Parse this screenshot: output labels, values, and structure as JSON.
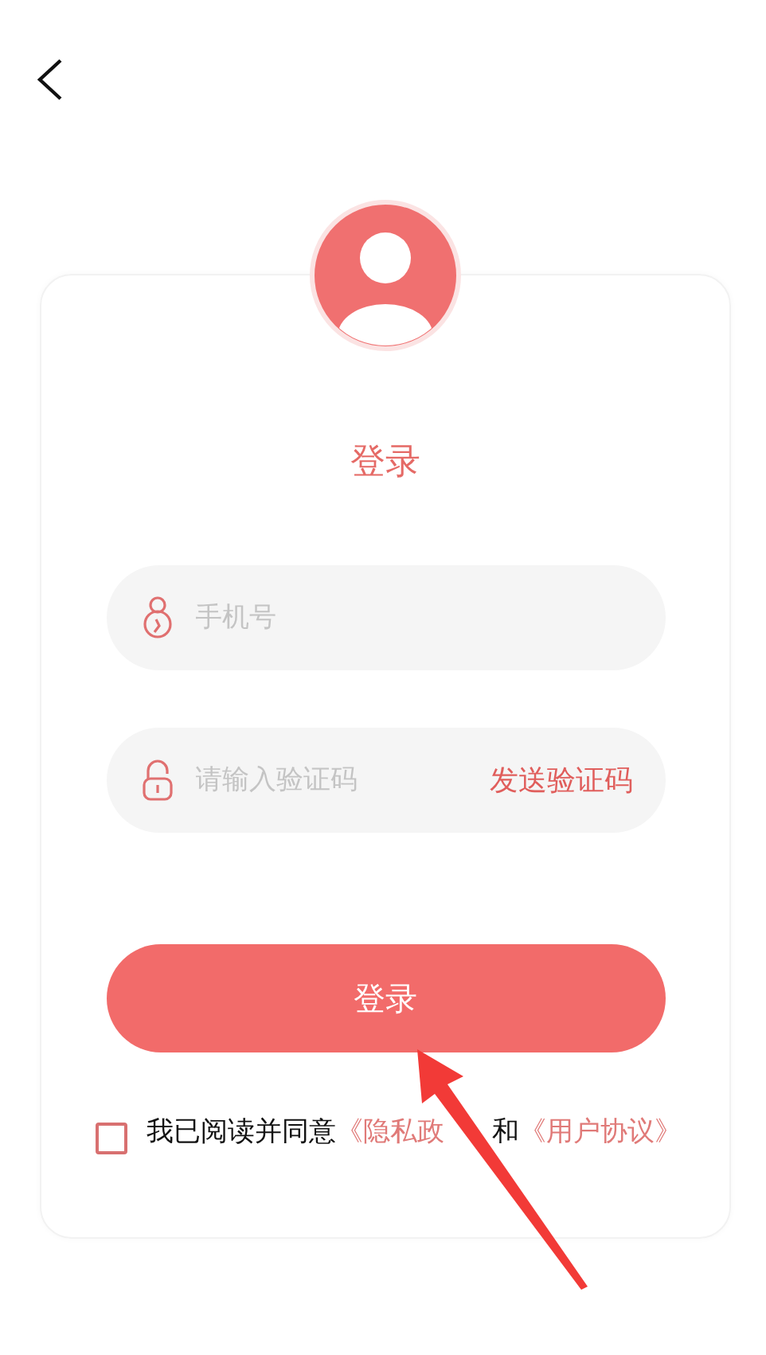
{
  "title": "登录",
  "phone_field": {
    "placeholder": "手机号"
  },
  "code_field": {
    "placeholder": "请输入验证码",
    "action": "发送验证码"
  },
  "login_button": "登录",
  "agreement": {
    "checked": false,
    "parts": [
      {
        "kind": "text",
        "text": "我已阅读并同意"
      },
      {
        "kind": "link",
        "text": "《隐私政"
      },
      {
        "kind": "text",
        "text": "和"
      },
      {
        "kind": "link",
        "text": "《用户协议》"
      }
    ]
  },
  "annotation": {
    "kind": "arrow"
  }
}
